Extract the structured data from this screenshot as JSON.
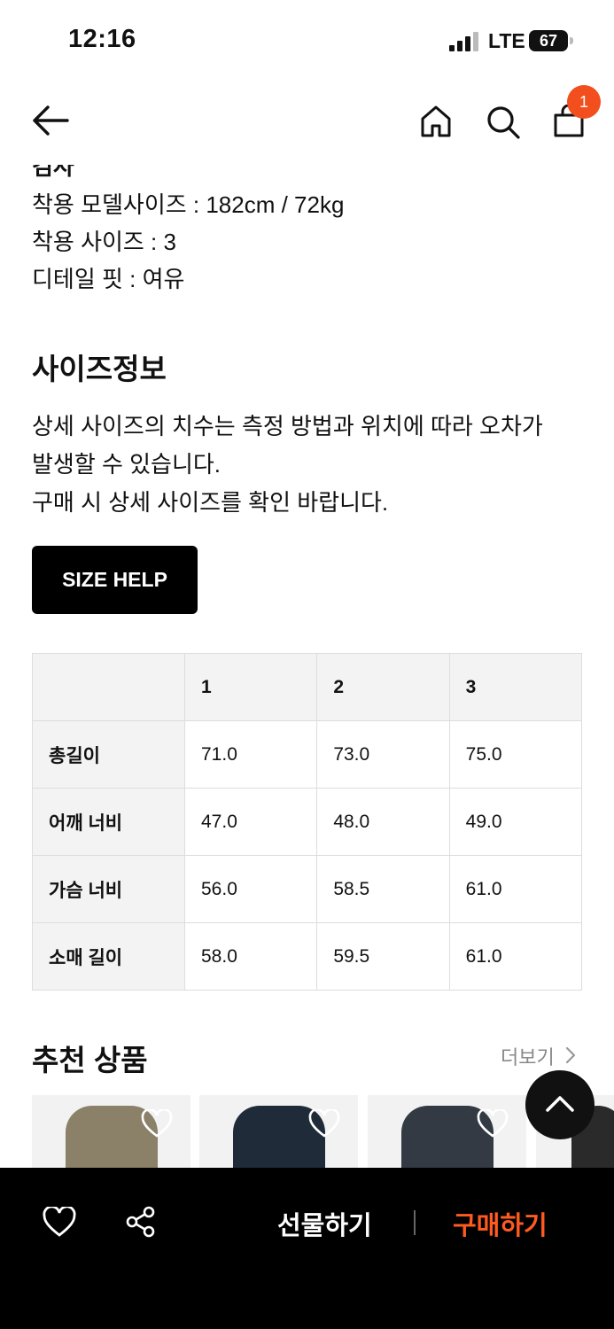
{
  "status_bar": {
    "time": "12:16",
    "network": "LTE",
    "battery": "67"
  },
  "nav": {
    "cart_count": "1"
  },
  "product_info": {
    "cut_text": "검사",
    "lines": [
      "착용 모델사이즈 : 182cm / 72kg",
      "착용 사이즈 : 3",
      "디테일 핏 : 여유"
    ]
  },
  "size_section": {
    "title": "사이즈정보",
    "desc": [
      "상세 사이즈의 치수는 측정 방법과 위치에 따라 오차가",
      "발생할 수 있습니다.",
      "구매 시 상세 사이즈를 확인 바랍니다."
    ],
    "help_button": "SIZE HELP",
    "table": {
      "columns": [
        "",
        "1",
        "2",
        "3"
      ],
      "rows": [
        {
          "label": "총길이",
          "values": [
            "71.0",
            "73.0",
            "75.0"
          ]
        },
        {
          "label": "어깨 너비",
          "values": [
            "47.0",
            "48.0",
            "49.0"
          ]
        },
        {
          "label": "가슴 너비",
          "values": [
            "56.0",
            "58.5",
            "61.0"
          ]
        },
        {
          "label": "소매 길이",
          "values": [
            "58.0",
            "59.5",
            "61.0"
          ]
        }
      ]
    }
  },
  "recommend": {
    "title": "추천 상품",
    "more": "더보기",
    "items": [
      {
        "icon": "jacket-olive",
        "color": "#8b8068"
      },
      {
        "icon": "jacket-navy",
        "color": "#1f2b38"
      },
      {
        "icon": "jacket-charcoal",
        "color": "#333a44"
      }
    ]
  },
  "bottom_bar": {
    "gift_label": "선물하기",
    "buy_label": "구매하기",
    "accent": "#ff5a1f"
  }
}
